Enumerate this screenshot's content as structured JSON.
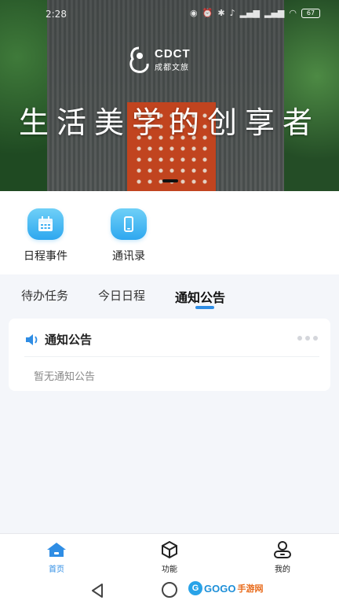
{
  "status_bar": {
    "time": "2:28",
    "icons": [
      "eye",
      "alarm",
      "bluetooth",
      "mute",
      "signal",
      "signal",
      "wifi"
    ],
    "battery": "67"
  },
  "banner": {
    "logo_en": "CDCT",
    "logo_cn": "成都文旅",
    "slogan": "生活美学的创享者"
  },
  "shortcuts": [
    {
      "label": "日程事件",
      "icon": "calendar-icon"
    },
    {
      "label": "通讯录",
      "icon": "phone-icon"
    }
  ],
  "tabs": [
    {
      "label": "待办任务",
      "active": false
    },
    {
      "label": "今日日程",
      "active": false
    },
    {
      "label": "通知公告",
      "active": true
    }
  ],
  "notice_card": {
    "title": "通知公告",
    "empty_text": "暂无通知公告"
  },
  "tabbar": [
    {
      "label": "首页",
      "icon": "home-icon",
      "active": true
    },
    {
      "label": "功能",
      "icon": "cube-icon",
      "active": false
    },
    {
      "label": "我的",
      "icon": "user-icon",
      "active": false
    }
  ],
  "watermark": {
    "g": "G",
    "text": "GOGO",
    "cn": "手游网"
  },
  "colors": {
    "accent": "#2f8de4",
    "shortcut_gradient_top": "#6fd0f7",
    "shortcut_gradient_bottom": "#2ea7ef",
    "courtyard": "#c1441f"
  }
}
